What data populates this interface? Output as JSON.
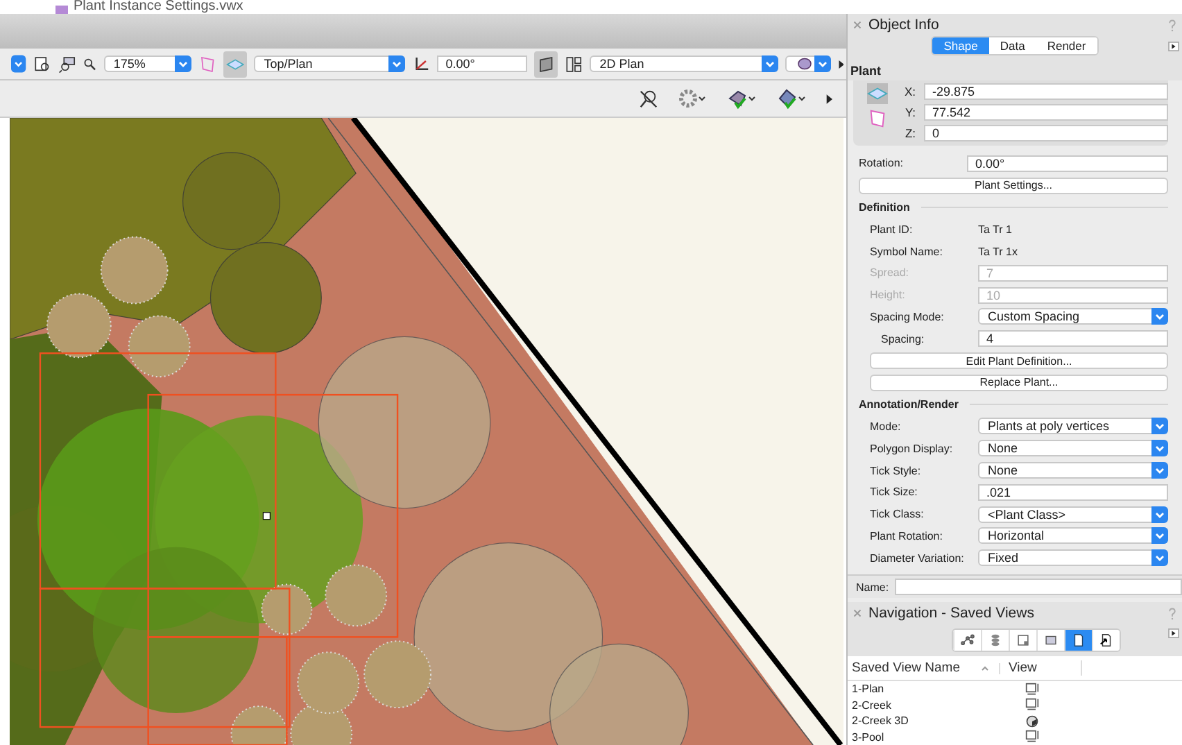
{
  "document": {
    "title": "Plant Instance Settings.vwx"
  },
  "view_bar": {
    "zoom": "175%",
    "view": "Top/Plan",
    "rotation": "0.00°",
    "render_mode": "2D Plan"
  },
  "object_info": {
    "title": "Object Info",
    "tabs": [
      {
        "label": "Shape",
        "selected": true
      },
      {
        "label": "Data",
        "selected": false
      },
      {
        "label": "Render",
        "selected": false
      }
    ],
    "object_type": "Plant",
    "coords": [
      {
        "label": "X:",
        "value": "-29.875"
      },
      {
        "label": "Y:",
        "value": "77.542"
      },
      {
        "label": "Z:",
        "value": "0"
      }
    ],
    "rows": [
      {
        "kind": "field",
        "label": "Rotation:",
        "value": "0.00°",
        "disabled": false
      },
      {
        "kind": "button",
        "label": "Plant Settings..."
      },
      {
        "kind": "section",
        "label": "Definition"
      },
      {
        "kind": "static",
        "label": "Plant ID:",
        "value": "Ta Tr 1"
      },
      {
        "kind": "static",
        "label": "Symbol Name:",
        "value": "Ta Tr 1x"
      },
      {
        "kind": "field",
        "label": "Spread:",
        "value": "7",
        "disabled": true
      },
      {
        "kind": "field",
        "label": "Height:",
        "value": "10",
        "disabled": true
      },
      {
        "kind": "select",
        "label": "Spacing Mode:",
        "value": "Custom Spacing"
      },
      {
        "kind": "subfield",
        "label": "Spacing:",
        "value": "4"
      },
      {
        "kind": "button",
        "label": "Edit Plant Definition..."
      },
      {
        "kind": "button",
        "label": "Replace Plant..."
      },
      {
        "kind": "section",
        "label": "Annotation/Render"
      },
      {
        "kind": "select",
        "label": "Mode:",
        "value": "Plants at poly vertices"
      },
      {
        "kind": "select",
        "label": "Polygon Display:",
        "value": "None"
      },
      {
        "kind": "select",
        "label": "Tick Style:",
        "value": "None"
      },
      {
        "kind": "field",
        "label": "Tick Size:",
        "value": ".021",
        "disabled": false
      },
      {
        "kind": "select",
        "label": "Tick Class:",
        "value": "<Plant Class>"
      },
      {
        "kind": "select",
        "label": "Plant Rotation:",
        "value": "Horizontal"
      },
      {
        "kind": "select",
        "label": "Diameter Variation:",
        "value": "Fixed"
      }
    ],
    "name_label": "Name:"
  },
  "navigation": {
    "title": "Navigation - Saved Views",
    "tabs": [
      {
        "selected": false
      },
      {
        "selected": false
      },
      {
        "selected": false
      },
      {
        "selected": false
      },
      {
        "selected": true
      },
      {
        "selected": false
      }
    ],
    "columns": [
      "Saved View Name",
      "View"
    ],
    "rows": [
      {
        "name": "1-Plan",
        "kind": "plan"
      },
      {
        "name": "2-Creek",
        "kind": "plan"
      },
      {
        "name": "2-Creek 3D",
        "kind": "render"
      },
      {
        "name": "3-Pool",
        "kind": "plan"
      }
    ]
  }
}
